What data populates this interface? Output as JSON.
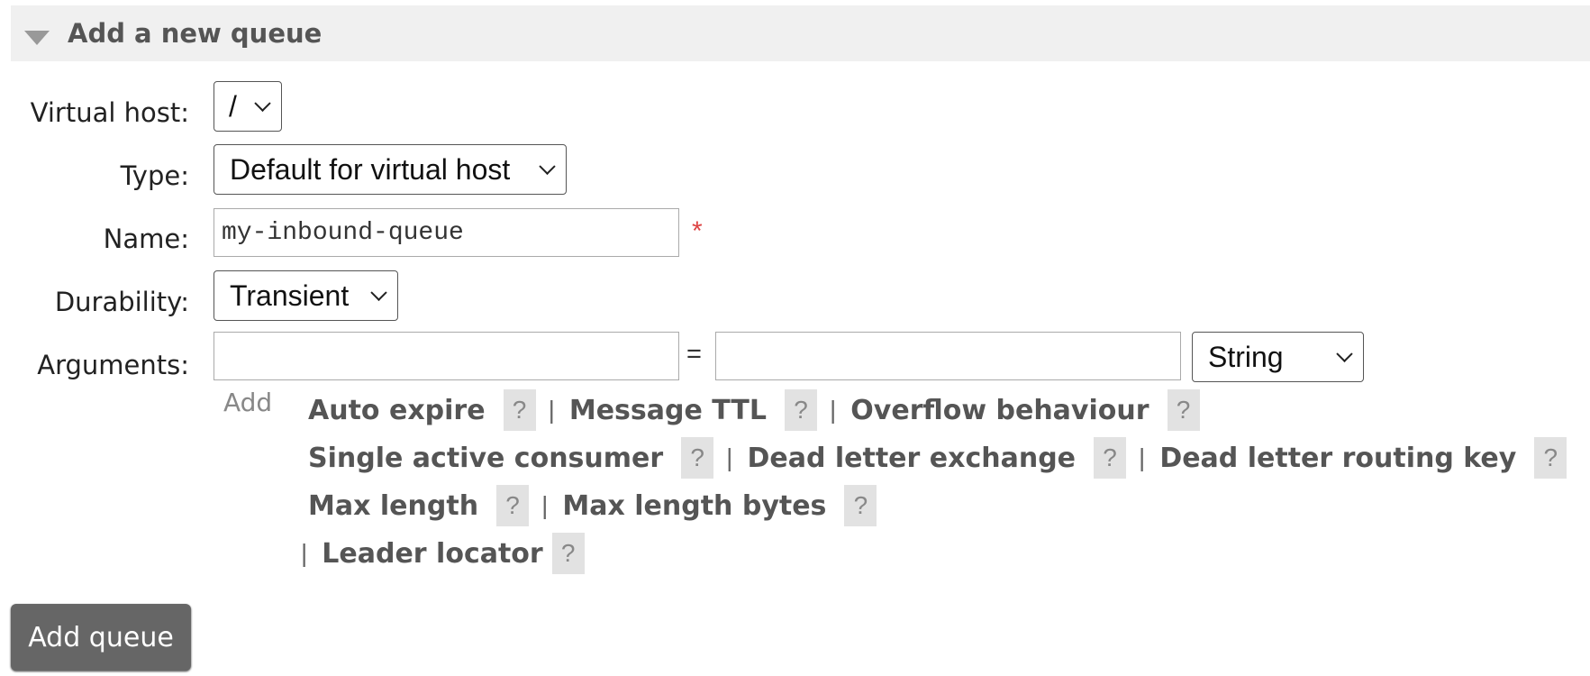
{
  "section": {
    "title": "Add a new queue"
  },
  "form": {
    "vhost": {
      "label": "Virtual host:",
      "value": "/"
    },
    "type": {
      "label": "Type:",
      "value": "Default for virtual host"
    },
    "name": {
      "label": "Name:",
      "value": "my-inbound-queue",
      "required_mark": "*"
    },
    "durability": {
      "label": "Durability:",
      "value": "Transient"
    },
    "arguments": {
      "label": "Arguments:",
      "key_value": "",
      "equals": "=",
      "value_value": "",
      "type_value": "String",
      "add_label": "Add",
      "help": "?",
      "separator": "|",
      "shortcuts": [
        "Auto expire",
        "Message TTL",
        "Overflow behaviour",
        "Single active consumer",
        "Dead letter exchange",
        "Dead letter routing key",
        "Max length",
        "Max length bytes",
        "Leader locator"
      ]
    }
  },
  "submit": {
    "label": "Add queue"
  },
  "colors": {
    "header_bg": "#f0f0f0",
    "button_bg": "#666666",
    "help_bg": "#e2e2e2",
    "required": "#dd4444"
  }
}
